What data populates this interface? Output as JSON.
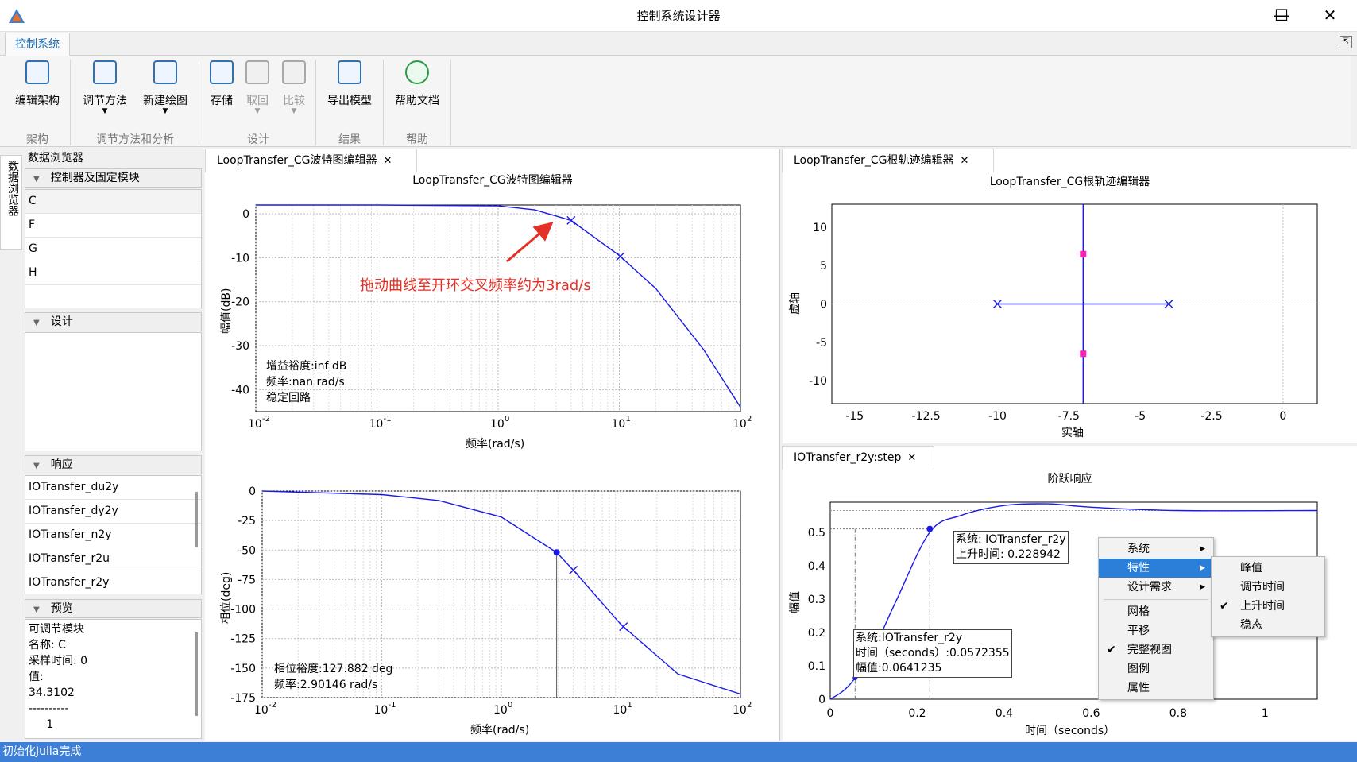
{
  "window": {
    "title": "控制系统设计器",
    "min": "—",
    "max": "☐",
    "close": "✕"
  },
  "ribbon": {
    "tab": "控制系统",
    "buttons": {
      "edit_arch": "编辑架构",
      "tune_method": "调节方法",
      "new_plot": "新建绘图",
      "store": "存储",
      "retrieve": "取回",
      "compare": "比较",
      "export_model": "导出模型",
      "help_doc": "帮助文档"
    },
    "groups": {
      "arch": "架构",
      "tune": "调节方法和分析",
      "design": "设计",
      "result": "结果",
      "help": "帮助"
    }
  },
  "sidebar": {
    "vertical_tab": "数据浏览器",
    "title": "数据浏览器",
    "controllers": {
      "header": "控制器及固定模块",
      "items": [
        "C",
        "F",
        "G",
        "H"
      ]
    },
    "design": {
      "header": "设计"
    },
    "responses": {
      "header": "响应",
      "items": [
        "IOTransfer_du2y",
        "IOTransfer_dy2y",
        "IOTransfer_n2y",
        "IOTransfer_r2u",
        "IOTransfer_r2y"
      ]
    },
    "preview": {
      "header": "预览",
      "lines": [
        "可调节模块",
        "名称:  C",
        "采样时间:  0",
        "值:",
        "34.3102",
        "----------",
        "     1"
      ]
    }
  },
  "bode": {
    "tab": "LoopTransfer_CG波特图编辑器",
    "title": "LoopTransfer_CG波特图编辑器",
    "mag": {
      "ylabel": "幅值(dB)",
      "xlabel": "频率(rad/s)",
      "yticks": [
        "0",
        "-10",
        "-20",
        "-30",
        "-40"
      ],
      "info": [
        "增益裕度:inf dB",
        "频率:nan rad/s",
        "稳定回路"
      ],
      "annotation": "拖动曲线至开环交叉频率约为3rad/s"
    },
    "phase": {
      "ylabel": "相位(deg)",
      "xlabel": "频率(rad/s)",
      "yticks": [
        "0",
        "-25",
        "-50",
        "-75",
        "-100",
        "-125",
        "-150",
        "-175"
      ],
      "info": [
        "相位裕度:127.882 deg",
        "频率:2.90146 rad/s"
      ]
    },
    "xticks": [
      "-2",
      "-1",
      "0",
      "1",
      "2"
    ],
    "xbase": "10"
  },
  "rlocus": {
    "tab": "LoopTransfer_CG根轨迹编辑器",
    "title": "LoopTransfer_CG根轨迹编辑器",
    "xlabel": "实轴",
    "ylabel": "虚轴",
    "xticks": [
      "-15",
      "-12.5",
      "-10",
      "-7.5",
      "-5",
      "-2.5",
      "0"
    ],
    "yticks": [
      "10",
      "5",
      "0",
      "-5",
      "-10"
    ]
  },
  "step": {
    "tab": "IOTransfer_r2y:step",
    "title": "阶跃响应",
    "xlabel": "时间（seconds）",
    "ylabel": "幅值",
    "xticks": [
      "0",
      "0.2",
      "0.4",
      "0.6",
      "0.8",
      "1"
    ],
    "yticks": [
      "0.5",
      "0.4",
      "0.3",
      "0.2",
      "0.1",
      "0"
    ],
    "tip1": [
      "系统:  IOTransfer_r2y",
      "上升时间:  0.228942"
    ],
    "tip2": [
      "系统:IOTransfer_r2y",
      "时间（seconds）:0.0572355",
      "幅值:0.0641235"
    ]
  },
  "context_menu": {
    "items": [
      "系统",
      "特性",
      "设计需求",
      "网格",
      "平移",
      "完整视图",
      "图例",
      "属性"
    ],
    "submenu": [
      "峰值",
      "调节时间",
      "上升时间",
      "稳态"
    ]
  },
  "status": "初始化Julia完成",
  "chart_data": [
    {
      "type": "line",
      "title": "",
      "xlabel": "频率(rad/s)",
      "ylabel": "幅值(dB)",
      "xscale": "log",
      "xlim": [
        0.01,
        100
      ],
      "ylim": [
        -45,
        2
      ],
      "x": [
        0.01,
        0.1,
        1,
        2,
        3,
        4,
        10,
        20,
        50,
        100
      ],
      "values": [
        2,
        2,
        1.8,
        0.9,
        -0.5,
        -1.5,
        -9.5,
        -17,
        -31,
        -44
      ]
    },
    {
      "type": "line",
      "title": "",
      "xlabel": "频率(rad/s)",
      "ylabel": "相位(deg)",
      "xscale": "log",
      "xlim": [
        0.01,
        100
      ],
      "ylim": [
        -175,
        0
      ],
      "x": [
        0.01,
        0.1,
        0.3,
        1,
        2.9,
        4,
        10,
        30,
        100
      ],
      "values": [
        0,
        -3,
        -8,
        -22,
        -52,
        -67,
        -113,
        -155,
        -172
      ]
    },
    {
      "type": "scatter",
      "title": "",
      "xlabel": "实轴",
      "ylabel": "虚轴",
      "xlim": [
        -15.8,
        1.2
      ],
      "ylim": [
        -13,
        13
      ],
      "series": [
        {
          "name": "poles",
          "points": [
            [
              -10,
              0
            ],
            [
              -4,
              0
            ]
          ]
        },
        {
          "name": "zeros",
          "points": [
            [
              -7,
              6.5
            ],
            [
              -7,
              -6.5
            ]
          ]
        }
      ]
    },
    {
      "type": "line",
      "title": "",
      "xlabel": "时间（seconds）",
      "ylabel": "幅值",
      "xlim": [
        0,
        1.12
      ],
      "ylim": [
        0,
        0.59
      ],
      "x": [
        0,
        0.03,
        0.0572,
        0.1,
        0.15,
        0.229,
        0.3,
        0.4,
        0.5,
        0.6,
        0.8,
        1.12
      ],
      "values": [
        0,
        0.025,
        0.064,
        0.15,
        0.29,
        0.5,
        0.55,
        0.58,
        0.585,
        0.575,
        0.565,
        0.565
      ]
    }
  ]
}
